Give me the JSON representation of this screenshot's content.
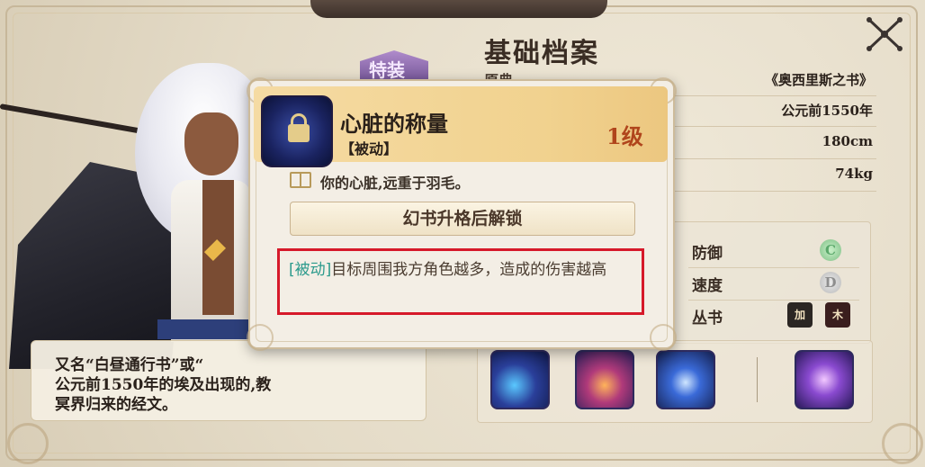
{
  "profile": {
    "title": "基础档案",
    "fields": [
      {
        "key": "原典",
        "value": "《奥西里斯之书》"
      },
      {
        "key": "",
        "value": "公元前1550年"
      },
      {
        "key": "",
        "value": "180cm"
      },
      {
        "key": "",
        "value": "74kg"
      }
    ],
    "spec_badge": "特装"
  },
  "stats": [
    {
      "label": "防御",
      "grade": "C"
    },
    {
      "label": "速度",
      "grade": "D"
    },
    {
      "label": "丛书",
      "grade": ""
    }
  ],
  "series_icons": [
    "加",
    "木"
  ],
  "description": "又名“白昼通行书”或“亡灵书”，是公元前1550年的埃及出现的，教导死者从冥界归来的经文。",
  "description_visible": "又名“白昼通行书”或“\n公元前1550年的埃及出现的,教\n冥界归来的经文。",
  "popup": {
    "skill_name": "心脏的称量",
    "skill_type": "【被动】",
    "level": "1级",
    "flavor": "你的心脏,远重于羽毛。",
    "unlock_button": "幻书升格后解锁",
    "effect_tag": "[被动]",
    "effect_text": "目标周围我方角色越多，造成的伤害越高"
  },
  "colors": {
    "accent_gold": "#f1d28f",
    "level_red": "#b0451c",
    "highlight_red": "#d6192a",
    "tag_teal": "#2b9a8c"
  },
  "icons": [
    "close-icon",
    "lock-icon",
    "book-icon",
    "grade-c-icon",
    "grade-d-icon"
  ]
}
